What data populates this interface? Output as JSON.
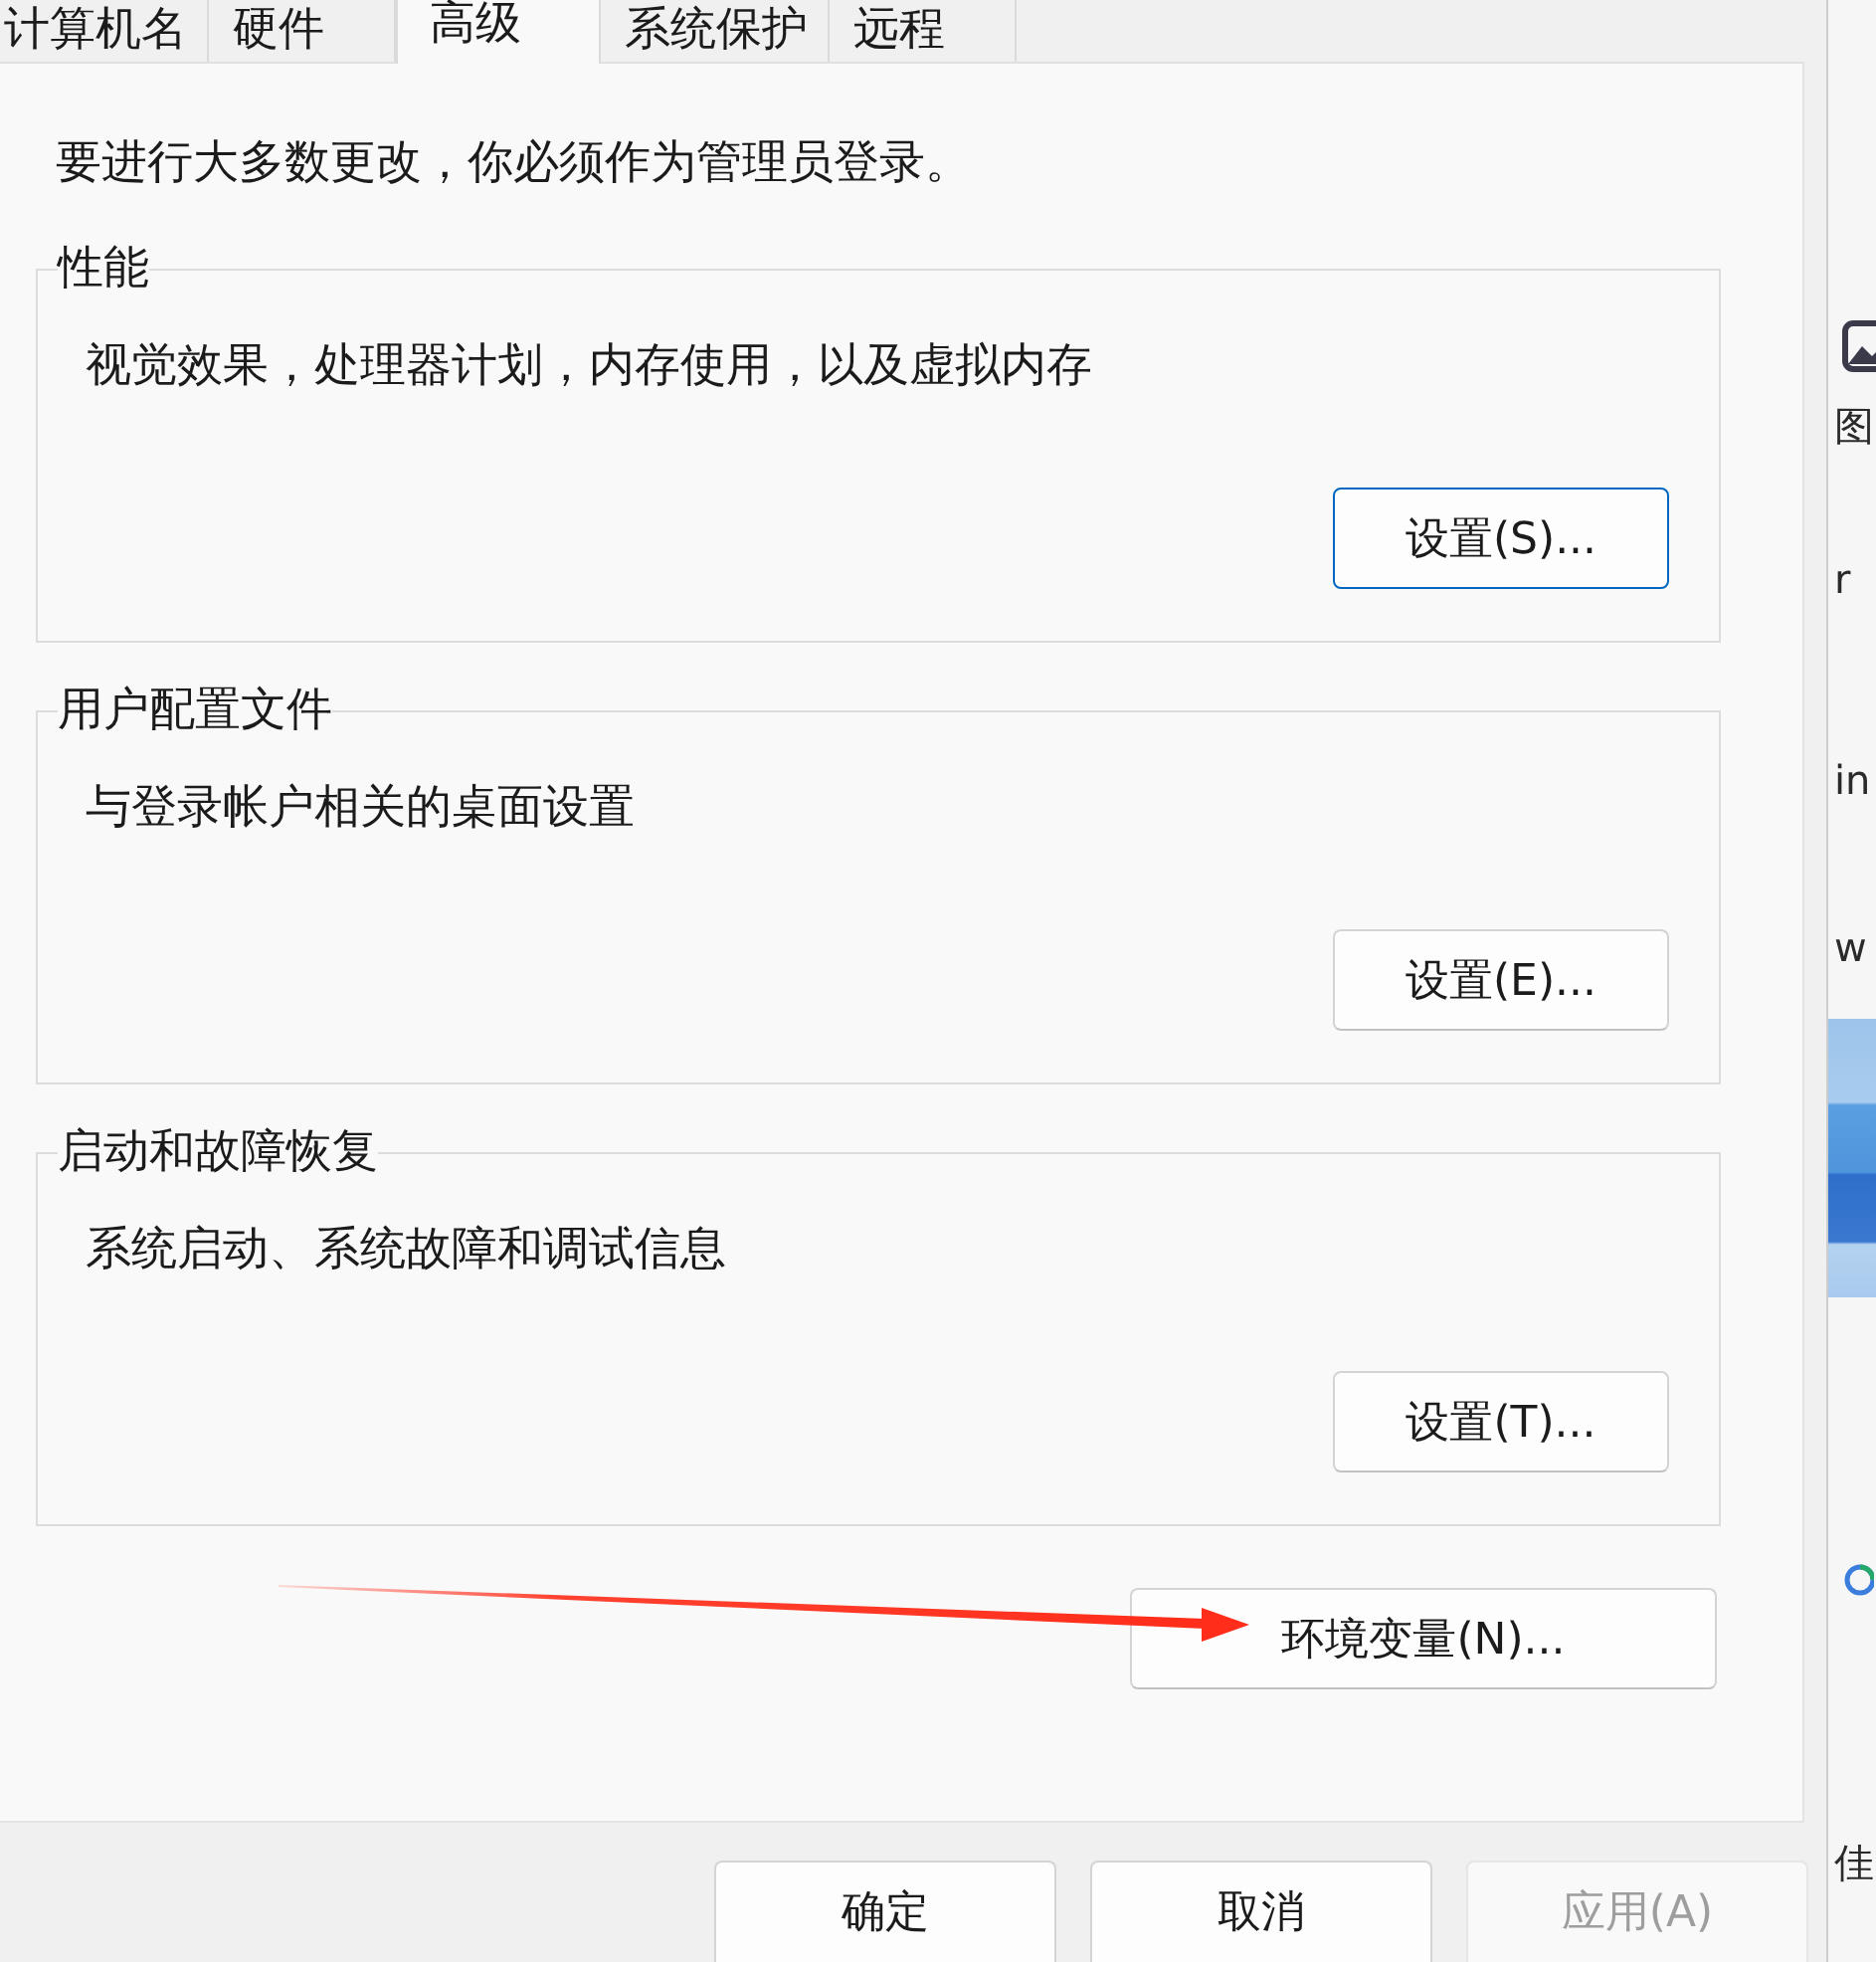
{
  "dialog": {
    "tabs": [
      {
        "label": "计算机名",
        "selected": false
      },
      {
        "label": "硬件",
        "selected": false
      },
      {
        "label": "高级",
        "selected": true
      },
      {
        "label": "系统保护",
        "selected": false
      },
      {
        "label": "远程",
        "selected": false
      }
    ],
    "notice": "要进行大多数更改，你必须作为管理员登录。",
    "groups": [
      {
        "title": "性能",
        "description": "视觉效果，处理器计划，内存使用，以及虚拟内存",
        "button": {
          "label": "设置(S)...",
          "focused": true
        }
      },
      {
        "title": "用户配置文件",
        "description": "与登录帐户相关的桌面设置",
        "button": {
          "label": "设置(E)...",
          "focused": false
        }
      },
      {
        "title": "启动和故障恢复",
        "description": "系统启动、系统故障和调试信息",
        "button": {
          "label": "设置(T)...",
          "focused": false
        }
      }
    ],
    "environment_button": "环境变量(N)...",
    "footer_buttons": [
      {
        "label": "确定",
        "disabled": false
      },
      {
        "label": "取消",
        "disabled": false
      },
      {
        "label": "应用(A)",
        "disabled": true
      }
    ]
  },
  "background_window": {
    "items": [
      {
        "kind": "picture_icon"
      },
      {
        "kind": "label",
        "text": "图"
      },
      {
        "kind": "label",
        "text": "r"
      },
      {
        "kind": "label",
        "text": "in"
      },
      {
        "kind": "label",
        "text": "w"
      },
      {
        "kind": "banner"
      },
      {
        "kind": "ring_icon"
      },
      {
        "kind": "label",
        "text": "佳"
      }
    ]
  }
}
